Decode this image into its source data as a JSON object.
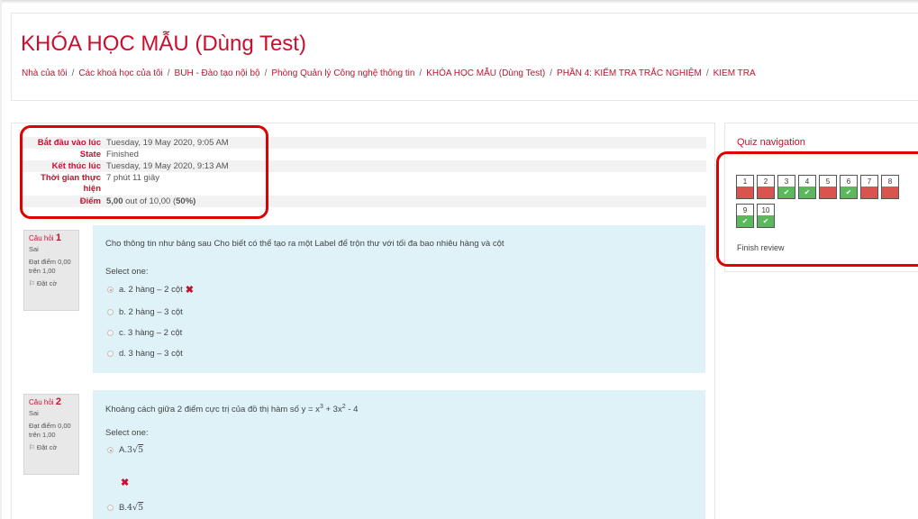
{
  "course": {
    "title": "KHÓA HỌC MẪU (Dùng Test)"
  },
  "breadcrumb": [
    "Nhà của tôi",
    "Các khoá học của tôi",
    "BUH - Đào tạo nội bộ",
    "Phòng Quản lý Công nghệ thông tin",
    "KHÓA HỌC MẪU (Dùng Test)",
    "PHẦN 4: KIỂM TRA TRẮC NGHIỆM",
    "KIEM TRA"
  ],
  "summary": {
    "started_label": "Bắt đầu vào lúc",
    "started_value": "Tuesday, 19 May 2020, 9:05 AM",
    "state_label": "State",
    "state_value": "Finished",
    "completed_label": "Kết thúc lúc",
    "completed_value": "Tuesday, 19 May 2020, 9:13 AM",
    "time_label_line1": "Thời gian thực",
    "time_label_line2": "hiện",
    "time_value": "7 phút 11 giây",
    "grade_label": "Điểm",
    "grade_score": "5,00",
    "grade_middle": " out of 10,00 (",
    "grade_percent": "50",
    "grade_end": "%)"
  },
  "questions": [
    {
      "label": "Câu hỏi",
      "number": "1",
      "state": "Sai",
      "mark_line1": "Đạt điểm 0,00",
      "mark_line2": "trên 1,00",
      "flag_label": "Đặt cờ",
      "text": "Cho thông tin như bảng sau Cho biết có thể tạo ra một Label để trộn thư với tối đa bao nhiêu hàng và cột",
      "select_one": "Select one:",
      "answers": [
        "a. 2 hàng – 2 cột",
        "b. 2 hàng – 3 cột",
        "c. 3 hàng – 2 cột",
        "d. 3 hàng – 3 cột"
      ],
      "selected_index": 0,
      "selected_correct": false
    },
    {
      "label": "Câu hỏi",
      "number": "2",
      "state": "Sai",
      "mark_line1": "Đạt điểm 0,00",
      "mark_line2": "trên 1,00",
      "flag_label": "Đặt cờ",
      "text_prefix": "Khoảng cách giữa 2 điểm cực trị của đồ thị hàm số y = x",
      "text_exp1": "3",
      "text_mid": " + 3x",
      "text_exp2": "2",
      "text_end": " - 4",
      "select_one": "Select one:",
      "answers": [
        {
          "prefix": "A. ",
          "coef": "3",
          "radicand": "5"
        },
        {
          "prefix": "B. ",
          "coef": "4",
          "radicand": "5"
        }
      ],
      "selected_index": 0,
      "selected_correct": false
    }
  ],
  "quiz_nav": {
    "title": "Quiz navigation",
    "finish_review": "Finish review",
    "buttons": [
      {
        "number": "1",
        "status": "incorrect"
      },
      {
        "number": "2",
        "status": "incorrect"
      },
      {
        "number": "3",
        "status": "correct"
      },
      {
        "number": "4",
        "status": "correct"
      },
      {
        "number": "5",
        "status": "incorrect"
      },
      {
        "number": "6",
        "status": "correct"
      },
      {
        "number": "7",
        "status": "incorrect"
      },
      {
        "number": "8",
        "status": "incorrect"
      },
      {
        "number": "9",
        "status": "correct"
      },
      {
        "number": "10",
        "status": "correct"
      }
    ]
  },
  "icons": {
    "wrong": "close-icon",
    "correct": "check-icon",
    "flag": "flag-icon"
  },
  "colors": {
    "brand_red": "#c8102e",
    "correct_green": "#5cb85c",
    "incorrect_red": "#d9534f",
    "question_bg": "#def2f8",
    "highlight_ring": "#e00000"
  }
}
